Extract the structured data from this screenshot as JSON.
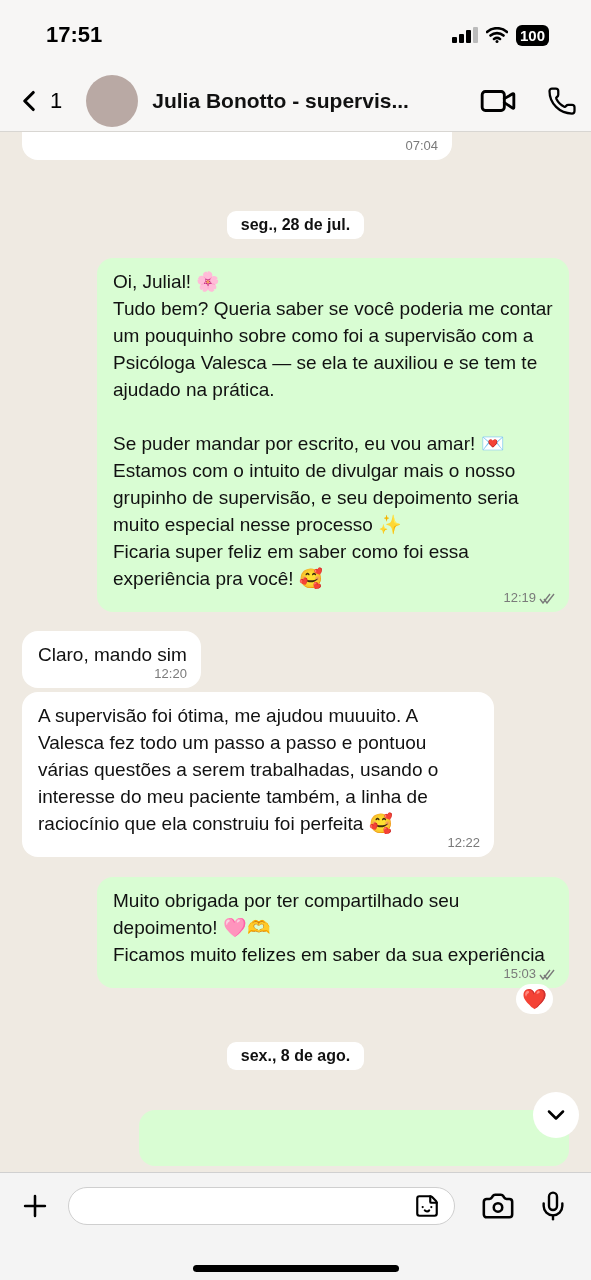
{
  "status_bar": {
    "time": "17:51",
    "battery": "100"
  },
  "header": {
    "back_count": "1",
    "title": "Julia Bonotto - supervis..."
  },
  "messages": [
    {
      "kind": "message",
      "outgoing": false,
      "time": "07:04"
    },
    {
      "kind": "date",
      "text": "seg., 28 de jul."
    },
    {
      "kind": "message",
      "outgoing": true,
      "text": "Oi, Julial! 🌸\nTudo bem? Queria saber se você poderia me contar um pouquinho sobre como foi a supervisão com a Psicóloga Valesca — se ela te auxiliou e se tem te ajudado na prática.\n\nSe puder mandar por escrito, eu vou amar! 💌\nEstamos com o intuito de divulgar mais o nosso grupinho de supervisão, e seu depoimento seria muito especial nesse processo ✨\nFicaria super feliz em saber como foi essa experiência pra você! 🥰",
      "time": "12:19",
      "read": false
    },
    {
      "kind": "message",
      "outgoing": false,
      "text": "Claro, mando sim",
      "time": "12:20"
    },
    {
      "kind": "message",
      "outgoing": false,
      "text": "A supervisão foi ótima, me ajudou muuuito. A Valesca fez todo um passo a passo e pontuou várias questões a serem trabalhadas, usando o interesse do meu paciente também, a linha de raciocínio que ela construiu foi perfeita 🥰",
      "time": "12:22"
    },
    {
      "kind": "message",
      "outgoing": true,
      "text": "Muito obrigada por ter compartilhado seu depoimento! 🩷🫶\nFicamos muito felizes em saber da sua experiência",
      "time": "15:03",
      "read": false,
      "reaction": "❤️"
    },
    {
      "kind": "date",
      "text": "sex., 8 de ago."
    },
    {
      "kind": "message",
      "outgoing": true
    }
  ]
}
